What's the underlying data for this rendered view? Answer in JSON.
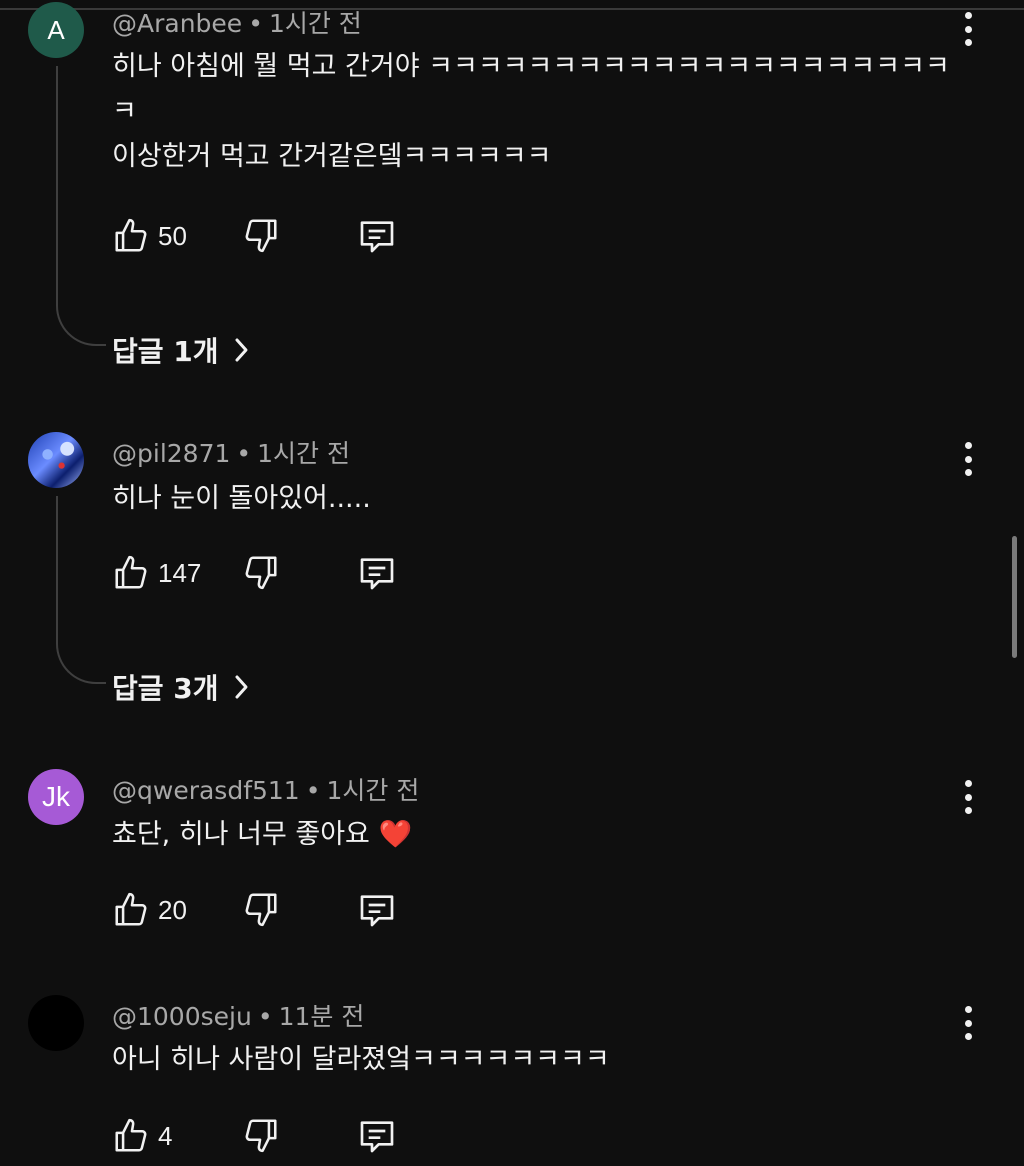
{
  "comments": [
    {
      "avatar_letter": "A",
      "author": "@Aranbee",
      "time": "1시간 전",
      "text": "히나 아침에 뭘 먹고 간거야 ㅋㅋㅋㅋㅋㅋㅋㅋㅋㅋㅋㅋㅋㅋㅋㅋㅋㅋㅋㅋㅋ\nㅋ\n이상한거 먹고 간거같은뎈ㅋㅋㅋㅋㅋㅋ",
      "likes": "50",
      "replies_label": "답글 1개"
    },
    {
      "avatar_letter": "",
      "author": "@pil2871",
      "time": "1시간 전",
      "text": "히나 눈이 돌아있어.....",
      "likes": "147",
      "replies_label": "답글 3개"
    },
    {
      "avatar_letter": "Jk",
      "author": "@qwerasdf511",
      "time": "1시간 전",
      "text": "쵸단, 히나 너무 좋아요",
      "emoji": "❤️",
      "likes": "20"
    },
    {
      "avatar_letter": "",
      "author": "@1000seju",
      "time": "11분 전",
      "text": "아니 히나 사람이 달라졌엌ㅋㅋㅋㅋㅋㅋㅋㅋ",
      "likes": "4"
    }
  ],
  "colors": {
    "background": "#0f0f0f",
    "text": "#f1f1f1",
    "meta": "#a8a8a8",
    "heart": "#e0262d"
  },
  "icons": [
    "like-icon",
    "dislike-icon",
    "reply-icon",
    "more-icon",
    "chevron-right-icon"
  ]
}
